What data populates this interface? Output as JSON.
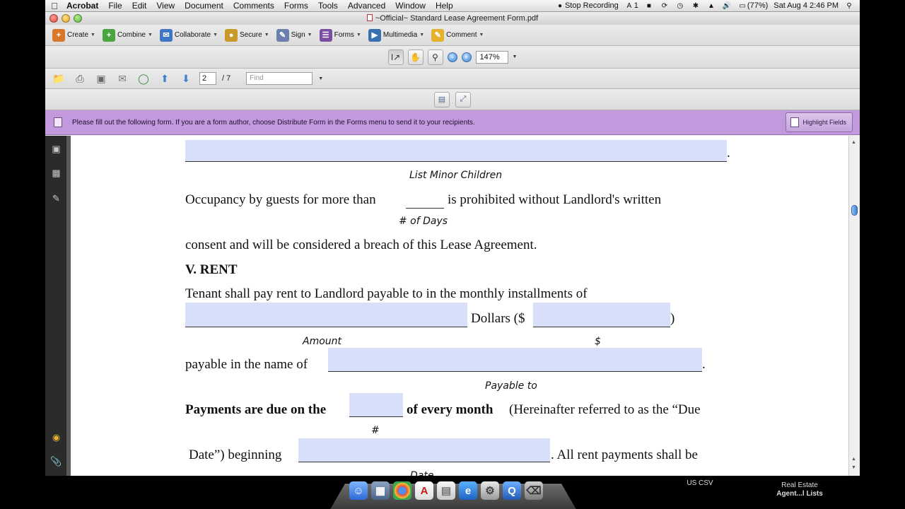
{
  "menubar": {
    "app_name": "Acrobat",
    "menus": [
      "File",
      "Edit",
      "View",
      "Document",
      "Comments",
      "Forms",
      "Tools",
      "Advanced",
      "Window",
      "Help"
    ],
    "status": {
      "recording": "Stop Recording",
      "badge_count": "1",
      "battery": "(77%)",
      "datetime": "Sat Aug 4  2:46 PM"
    }
  },
  "window": {
    "title": "~Official~ Standard Lease Agreement Form.pdf"
  },
  "tasks_toolbar": {
    "items": [
      {
        "label": "Create",
        "icon": "create-icon",
        "color": "#d9772b"
      },
      {
        "label": "Combine",
        "icon": "combine-icon",
        "color": "#4aa53e"
      },
      {
        "label": "Collaborate",
        "icon": "collaborate-icon",
        "color": "#3f77c4"
      },
      {
        "label": "Secure",
        "icon": "lock-icon",
        "color": "#c99a2a"
      },
      {
        "label": "Sign",
        "icon": "pen-icon",
        "color": "#6b7fae"
      },
      {
        "label": "Forms",
        "icon": "forms-icon",
        "color": "#7a4ea0"
      },
      {
        "label": "Multimedia",
        "icon": "multimedia-icon",
        "color": "#3a6fb0"
      },
      {
        "label": "Comment",
        "icon": "comment-icon",
        "color": "#e6b12e"
      }
    ]
  },
  "select_toolbar": {
    "zoom_value": "147%"
  },
  "nav_toolbar": {
    "current_page": "2",
    "total_pages": "/ 7",
    "find_placeholder": "Find"
  },
  "form_bar": {
    "message": "Please fill out the following form. If you are a form author, choose Distribute Form in the Forms menu to send it to your recipients.",
    "highlight_button": "Highlight Fields",
    "color": "#c399dd"
  },
  "document": {
    "minor_children_label": "List Minor Children",
    "occupancy_line_start": "Occupancy by guests for more than",
    "occupancy_line_end": "is prohibited without Landlord's written",
    "days_label": "# of Days",
    "consent_line": "consent and will be considered a breach of this Lease Agreement.",
    "section_heading": "V. RENT",
    "rent_line": "Tenant shall pay rent to Landlord payable to in the monthly installments of",
    "dollars_text": "Dollars ($",
    "close_paren": ")",
    "amount_label": "Amount",
    "dollar_label": "$",
    "payable_line": "payable in the name of",
    "period": ".",
    "payable_to_label": "Payable to",
    "payments_due_bold": "Payments are due on the",
    "every_month_bold": "of every month",
    "hereinafter": "(Hereinafter referred to as the “Due",
    "hash_label": "#",
    "due_date_start": "Date”) beginning",
    "rent_payments_end": ". All rent payments shall be",
    "date_label_partial": "Date"
  },
  "dock": {
    "right_label_1": "US CSV",
    "right_label_2": "Real Estate",
    "right_label_3": "Agent...l Lists"
  }
}
